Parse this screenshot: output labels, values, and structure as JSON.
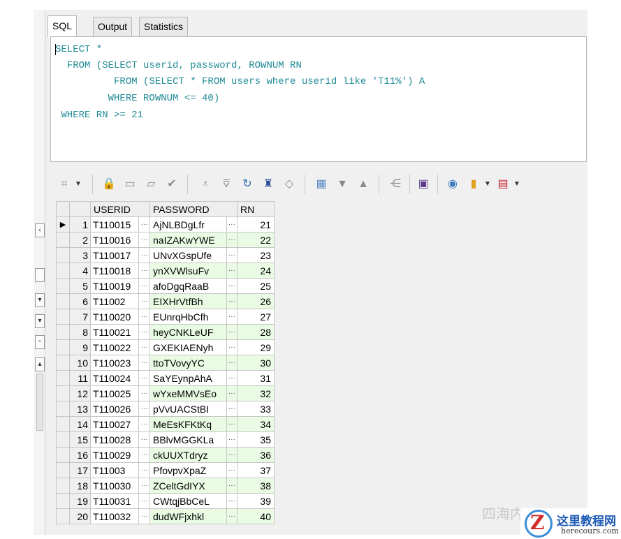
{
  "tabs": [
    "SQL",
    "Output",
    "Statistics"
  ],
  "editor": {
    "lines": [
      "SELECT *",
      "  FROM (SELECT userid, password, ROWNUM RN",
      "          FROM (SELECT * FROM users where userid like 'T11%') A",
      "         WHERE ROWNUM <= 40)",
      " WHERE RN >= 21"
    ]
  },
  "toolbar": {
    "icons": [
      "grid-icon",
      "dropdown-arrow-icon",
      "lock-icon",
      "new-record-icon",
      "comment-icon",
      "check-icon",
      "sort-desc-icon",
      "filter-icon",
      "refresh-icon",
      "find-icon",
      "clear-icon",
      "export-icon",
      "arrow-down-icon",
      "arrow-up-icon",
      "tree-icon",
      "save-icon",
      "db-icon",
      "chart-icon",
      "dropdown-arrow-icon",
      "table-icon",
      "dropdown-arrow-icon"
    ]
  },
  "grid": {
    "columns": [
      "USERID",
      "PASSWORD",
      "RN"
    ],
    "rows": [
      {
        "no": "1",
        "userid": "T110015",
        "password": "AjNLBDgLfr",
        "rn": "21"
      },
      {
        "no": "2",
        "userid": "T110016",
        "password": "naIZAKwYWE",
        "rn": "22"
      },
      {
        "no": "3",
        "userid": "T110017",
        "password": "UNvXGspUfe",
        "rn": "23"
      },
      {
        "no": "4",
        "userid": "T110018",
        "password": "ynXVWlsuFv",
        "rn": "24"
      },
      {
        "no": "5",
        "userid": "T110019",
        "password": "afoDgqRaaB",
        "rn": "25"
      },
      {
        "no": "6",
        "userid": "T11002",
        "password": "EIXHrVtfBh",
        "rn": "26"
      },
      {
        "no": "7",
        "userid": "T110020",
        "password": "EUnrqHbCfh",
        "rn": "27"
      },
      {
        "no": "8",
        "userid": "T110021",
        "password": "heyCNKLeUF",
        "rn": "28"
      },
      {
        "no": "9",
        "userid": "T110022",
        "password": "GXEKIAENyh",
        "rn": "29"
      },
      {
        "no": "10",
        "userid": "T110023",
        "password": "ttoTVovyYC",
        "rn": "30"
      },
      {
        "no": "11",
        "userid": "T110024",
        "password": "SaYEynpAhA",
        "rn": "31"
      },
      {
        "no": "12",
        "userid": "T110025",
        "password": "wYxeMMVsEo",
        "rn": "32"
      },
      {
        "no": "13",
        "userid": "T110026",
        "password": "pVvUACStBI",
        "rn": "33"
      },
      {
        "no": "14",
        "userid": "T110027",
        "password": "MeEsKFKtKq",
        "rn": "34"
      },
      {
        "no": "15",
        "userid": "T110028",
        "password": "BBlvMGGKLa",
        "rn": "35"
      },
      {
        "no": "16",
        "userid": "T110029",
        "password": "ckUUXTdryz",
        "rn": "36"
      },
      {
        "no": "17",
        "userid": "T11003",
        "password": "PfovpvXpaZ",
        "rn": "37"
      },
      {
        "no": "18",
        "userid": "T110030",
        "password": "ZCeltGdIYX",
        "rn": "38"
      },
      {
        "no": "19",
        "userid": "T110031",
        "password": "CWtqjBbCeL",
        "rn": "39"
      },
      {
        "no": "20",
        "userid": "T110032",
        "password": "dudWFjxhkl",
        "rn": "40"
      }
    ]
  },
  "watermark": {
    "text": "四海内",
    "logo_letter": "Z",
    "site_name": "这里教程网",
    "site_url": "herecours.com"
  }
}
